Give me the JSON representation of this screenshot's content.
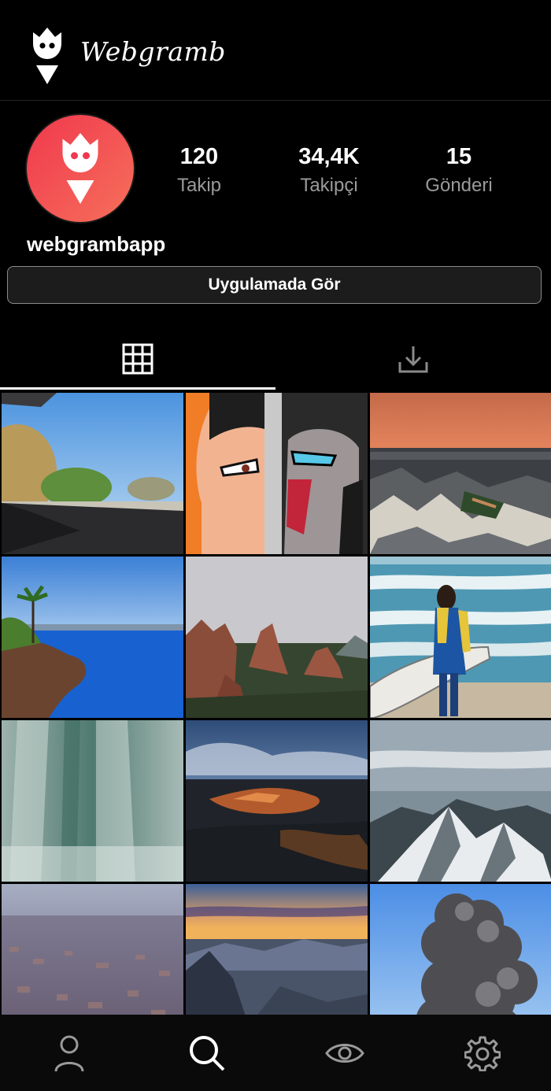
{
  "header": {
    "brand": "Webgramb",
    "logo_icon": "webgramb-logo-icon"
  },
  "profile": {
    "username": "webgrambapp",
    "avatar_icon": "webgramb-logo-icon",
    "stats": [
      {
        "value": "120",
        "label": "Takip"
      },
      {
        "value": "34,4K",
        "label": "Takipçi"
      },
      {
        "value": "15",
        "label": "Gönderi"
      }
    ],
    "view_in_app_label": "Uygulamada Gör"
  },
  "tabs": [
    {
      "icon": "grid-icon",
      "active": true
    },
    {
      "icon": "download-icon",
      "active": false
    }
  ],
  "posts": [
    "car-dashboard-road-photo",
    "animated-samurai-faces-image",
    "city-sunset-rooftops-photo",
    "tropical-cliff-ocean-photo",
    "red-rock-formations-photo",
    "surfer-woman-beach-photo",
    "waterfall-mist-photo",
    "canyon-storm-clouds-photo",
    "snowy-mountain-range-photo",
    "hazy-city-aerial-photo",
    "mountain-sunset-valley-photo",
    "volcanic-smoke-cloud-photo"
  ],
  "bottom_nav": [
    {
      "icon": "profile-icon"
    },
    {
      "icon": "search-icon"
    },
    {
      "icon": "eye-icon"
    },
    {
      "icon": "gear-icon"
    }
  ],
  "colors": {
    "background": "#000000",
    "avatar_gradient_start": "#f0384e",
    "avatar_gradient_end": "#f6705a",
    "muted_text": "#9a9a9a"
  }
}
